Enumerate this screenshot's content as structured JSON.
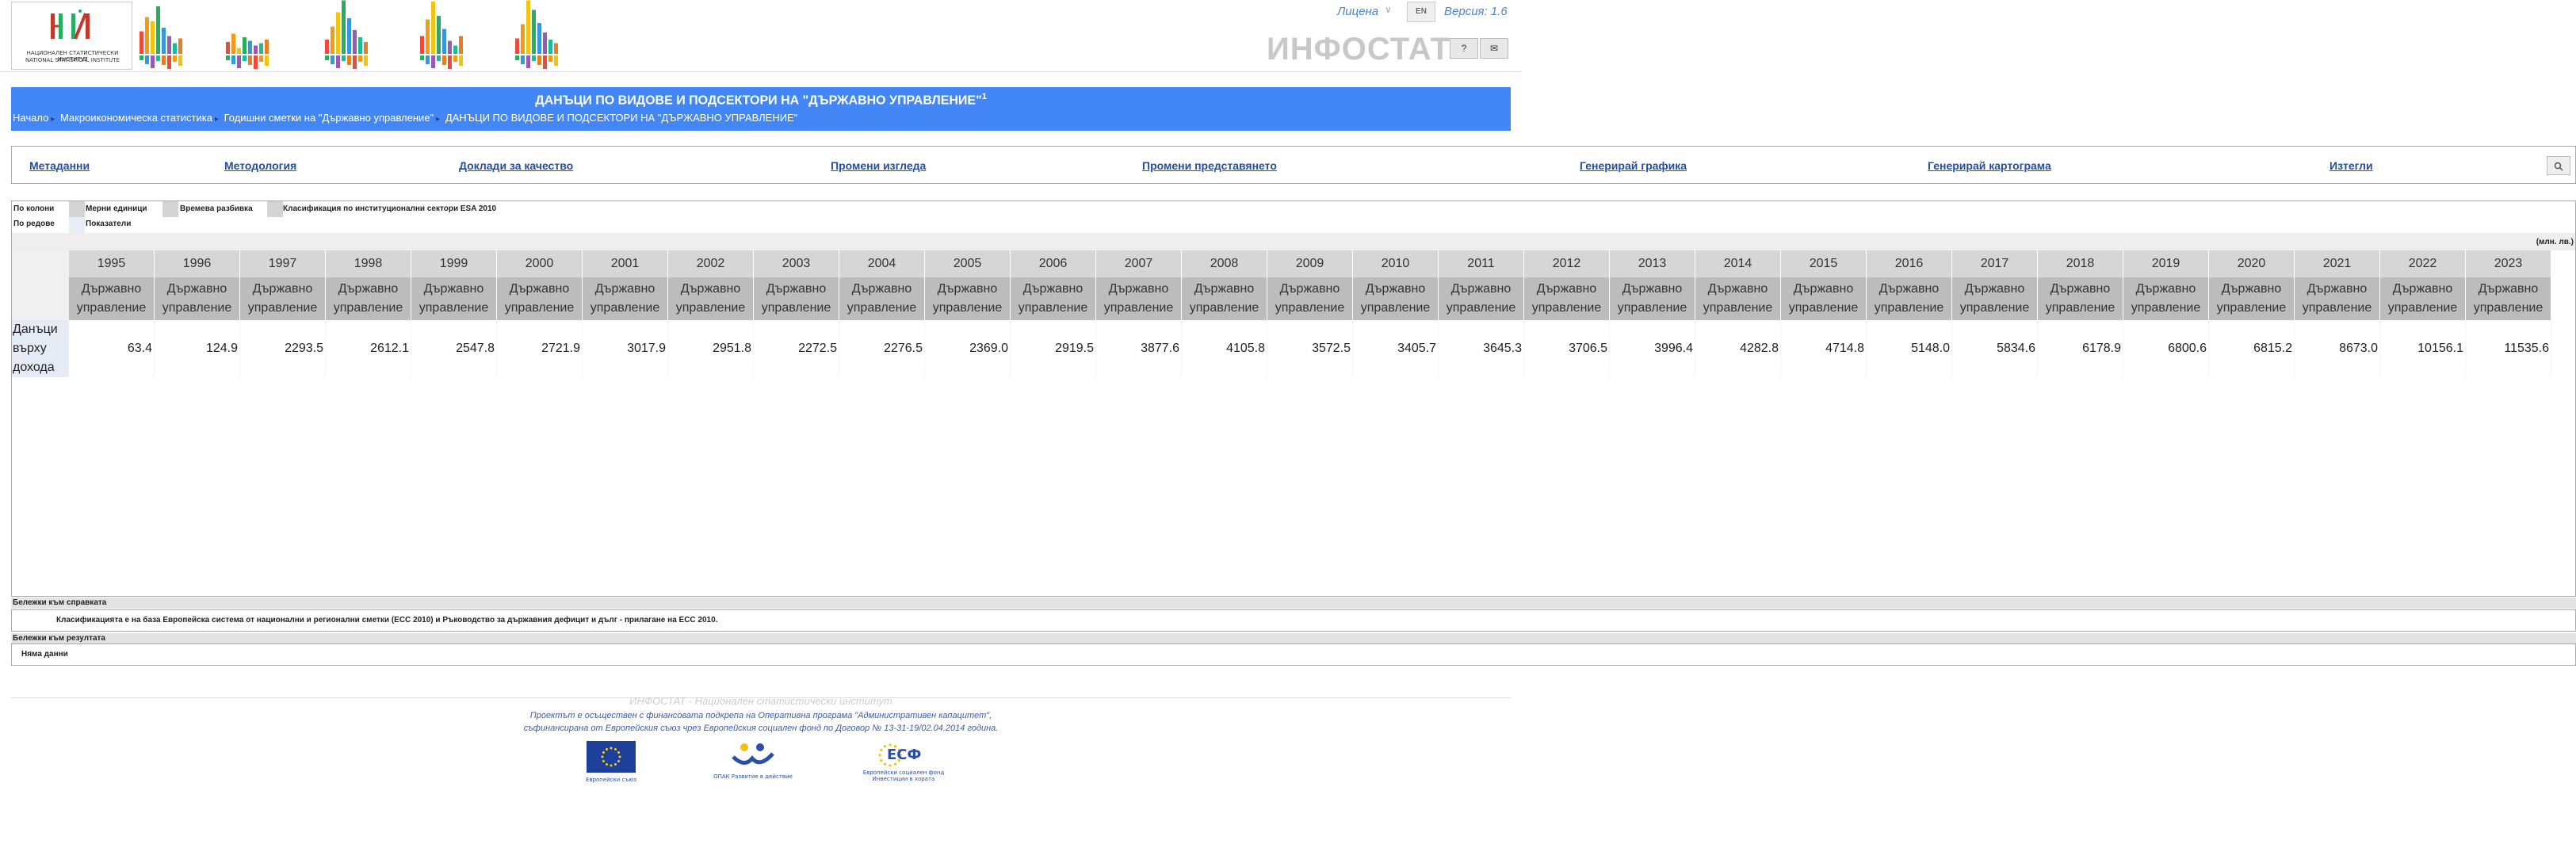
{
  "header": {
    "logo_line1": "НАЦИОНАЛЕН СТАТИСТИЧЕСКИ ИНСТИТУТ",
    "logo_line2": "NATIONAL STATISTICAL INSTITUTE",
    "brand": "ИНФОСТАТ",
    "login_label": "Лицена",
    "lang_button": "EN",
    "version": "Версия: 1.6",
    "help_label": "?",
    "mail_label": "✉"
  },
  "title": {
    "text": "ДАНЪЦИ ПО ВИДОВЕ И ПОДСЕКТОРИ НА \"ДЪРЖАВНО УПРАВЛЕНИЕ\"",
    "footnote": "1"
  },
  "breadcrumb": [
    "Начало",
    "Макроикономическа статистика",
    "Годишни сметки на \"Държавно управление\"",
    "ДАНЪЦИ ПО ВИДОВЕ И ПОДСЕКТОРИ НА \"ДЪРЖАВНО УПРАВЛЕНИЕ\""
  ],
  "toolbar": {
    "metadata": "Метаданни",
    "methodology": "Методология",
    "quality": "Доклади за качество",
    "change_view": "Промени изгледа",
    "change_presentation": "Промени представянето",
    "chart": "Генерирай графика",
    "map": "Генерирай картограма",
    "export": "Изтегли",
    "search_icon": "magnifier"
  },
  "pivot": {
    "columns_label": "По колони",
    "rows_label": "По редове",
    "col_dims": [
      "Мерни единици",
      "Времева разбивка",
      "Класификация по институционални сектори ESA 2010"
    ],
    "row_dims": [
      "Показатели"
    ],
    "units": "(млн. лв.)"
  },
  "table": {
    "years": [
      "1995",
      "1996",
      "1997",
      "1998",
      "1999",
      "2000",
      "2001",
      "2002",
      "2003",
      "2004",
      "2005",
      "2006",
      "2007",
      "2008",
      "2009",
      "2010",
      "2011",
      "2012",
      "2013",
      "2014",
      "2015",
      "2016",
      "2017",
      "2018",
      "2019",
      "2020",
      "2021",
      "2022",
      "2023"
    ],
    "sector_line1": "Държавно",
    "sector_line2": "управление",
    "row_label_lines": [
      "Данъци",
      "върху",
      "дохода"
    ],
    "values": [
      "63.4",
      "124.9",
      "2293.5",
      "2612.1",
      "2547.8",
      "2721.9",
      "3017.9",
      "2951.8",
      "2272.5",
      "2276.5",
      "2369.0",
      "2919.5",
      "3877.6",
      "4105.8",
      "3572.5",
      "3405.7",
      "3645.3",
      "3706.5",
      "3996.4",
      "4282.8",
      "4714.8",
      "5148.0",
      "5834.6",
      "6178.9",
      "6800.6",
      "6815.2",
      "8673.0",
      "10156.1",
      "11535.6"
    ]
  },
  "notes": {
    "ref_head": "Бележки към справката",
    "ref_text": "Класификацията е на база Европейска система от национални и регионални сметки (ЕСС 2010) и Ръководство за държавния дефицит и дълг - прилагане на ЕСС 2010.",
    "res_head": "Бележки към резултата",
    "res_text": "Няма данни"
  },
  "footer": {
    "title": "ИНФОСТАТ - Национален статистически институт",
    "line1": "Проектът е осъществен с финансовата подкрепа на Оперативна програма \"Административен капацитет\",",
    "line2": "съфинансирана от Европейския съюз чрез Европейския социален фонд по Договор № 13-31-19/02.04.2014 година.",
    "eu_caption": "Европейски съюз",
    "opak_caption": "ОПАК Развитие в действие",
    "esf_label": "ЕСФ",
    "esf_caption1": "Европейски социален фонд",
    "esf_caption2": "Инвестиции в хората"
  },
  "colors": {
    "title_bar": "#4287f5",
    "link": "#1f4fa8",
    "year_header": "#d6d6d6",
    "sector_header": "#bcbcbc",
    "row_header": "#e6ecf5"
  }
}
